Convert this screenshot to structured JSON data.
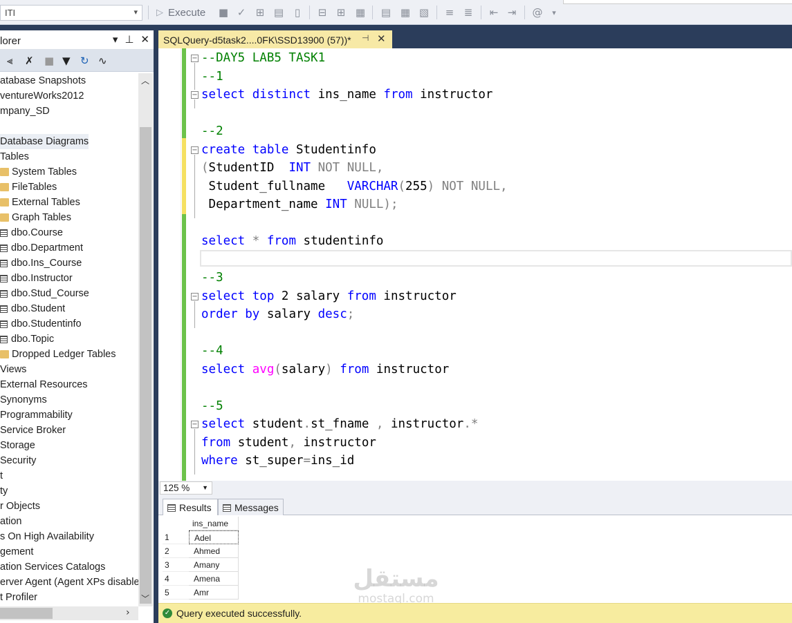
{
  "toolbar": {
    "database": "ITI",
    "execute_label": "Execute",
    "icons": [
      "stop-icon",
      "parse-icon",
      "estimated-plan-icon",
      "query-designer-icon",
      "save-icon",
      "results-to-text-icon",
      "results-to-grid-icon",
      "results-to-file-icon",
      "comment-icon",
      "uncomment-icon",
      "outdent-icon",
      "indent-icon",
      "specify-values-icon"
    ]
  },
  "explorer": {
    "title": "lorer",
    "tree": [
      {
        "label": "atabase Snapshots",
        "icon": "none",
        "indent": 0
      },
      {
        "label": "ventureWorks2012",
        "icon": "none",
        "indent": 0
      },
      {
        "label": "mpany_SD",
        "icon": "none",
        "indent": 0
      },
      {
        "label": "",
        "icon": "none",
        "indent": 0
      },
      {
        "label": "Database Diagrams",
        "icon": "none",
        "indent": 0,
        "selected": true
      },
      {
        "label": "Tables",
        "icon": "none",
        "indent": 0
      },
      {
        "label": "System Tables",
        "icon": "folder",
        "indent": 1
      },
      {
        "label": "FileTables",
        "icon": "folder",
        "indent": 1
      },
      {
        "label": "External Tables",
        "icon": "folder",
        "indent": 1
      },
      {
        "label": "Graph Tables",
        "icon": "folder",
        "indent": 1
      },
      {
        "label": "dbo.Course",
        "icon": "table",
        "indent": 1
      },
      {
        "label": "dbo.Department",
        "icon": "table",
        "indent": 1
      },
      {
        "label": "dbo.Ins_Course",
        "icon": "table",
        "indent": 1
      },
      {
        "label": "dbo.Instructor",
        "icon": "table",
        "indent": 1
      },
      {
        "label": "dbo.Stud_Course",
        "icon": "table",
        "indent": 1
      },
      {
        "label": "dbo.Student",
        "icon": "table",
        "indent": 1
      },
      {
        "label": "dbo.Studentinfo",
        "icon": "table",
        "indent": 1
      },
      {
        "label": "dbo.Topic",
        "icon": "table",
        "indent": 1
      },
      {
        "label": "Dropped Ledger Tables",
        "icon": "folder",
        "indent": 1
      },
      {
        "label": "Views",
        "icon": "none",
        "indent": 0
      },
      {
        "label": "External Resources",
        "icon": "none",
        "indent": 0
      },
      {
        "label": "Synonyms",
        "icon": "none",
        "indent": 0
      },
      {
        "label": "Programmability",
        "icon": "none",
        "indent": 0
      },
      {
        "label": "Service Broker",
        "icon": "none",
        "indent": 0
      },
      {
        "label": "Storage",
        "icon": "none",
        "indent": 0
      },
      {
        "label": "Security",
        "icon": "none",
        "indent": 0
      },
      {
        "label": "t",
        "icon": "none",
        "indent": 0
      },
      {
        "label": "ty",
        "icon": "none",
        "indent": 0
      },
      {
        "label": "r Objects",
        "icon": "none",
        "indent": 0
      },
      {
        "label": "ation",
        "icon": "none",
        "indent": 0
      },
      {
        "label": "s On High Availability",
        "icon": "none",
        "indent": 0
      },
      {
        "label": "gement",
        "icon": "none",
        "indent": 0
      },
      {
        "label": "ation Services Catalogs",
        "icon": "none",
        "indent": 0
      },
      {
        "label": "erver Agent (Agent XPs disable",
        "icon": "none",
        "indent": 0
      },
      {
        "label": "t Profiler",
        "icon": "none",
        "indent": 0
      }
    ]
  },
  "editor": {
    "tab_title": "SQLQuery-d5task2....0FK\\SSD13900 (57))*",
    "lines": [
      {
        "tokens": [
          [
            "cm",
            "--DAY5 LAB5 TASK1"
          ]
        ],
        "fold": "start"
      },
      {
        "tokens": [
          [
            "cm",
            "--1"
          ]
        ]
      },
      {
        "tokens": [
          [
            "kw",
            "select"
          ],
          [
            "tx",
            " "
          ],
          [
            "kw",
            "distinct"
          ],
          [
            "tx",
            " ins_name "
          ],
          [
            "kw",
            "from"
          ],
          [
            "tx",
            " instructor"
          ]
        ],
        "fold": "start"
      },
      {
        "tokens": []
      },
      {
        "tokens": [
          [
            "cm",
            "--2"
          ]
        ]
      },
      {
        "tokens": [
          [
            "kw",
            "create"
          ],
          [
            "tx",
            " "
          ],
          [
            "kw",
            "table"
          ],
          [
            "tx",
            " Studentinfo"
          ]
        ],
        "fold": "start"
      },
      {
        "tokens": [
          [
            "gr",
            "("
          ],
          [
            "tx",
            "StudentID  "
          ],
          [
            "kw",
            "INT"
          ],
          [
            "tx",
            " "
          ],
          [
            "gr",
            "NOT NULL,"
          ]
        ]
      },
      {
        "tokens": [
          [
            "tx",
            " Student_fullname   "
          ],
          [
            "kw",
            "VARCHAR"
          ],
          [
            "gr",
            "("
          ],
          [
            "tx",
            "255"
          ],
          [
            "gr",
            ")"
          ],
          [
            "tx",
            " "
          ],
          [
            "gr",
            "NOT NULL,"
          ]
        ]
      },
      {
        "tokens": [
          [
            "tx",
            " Department_name "
          ],
          [
            "kw",
            "INT"
          ],
          [
            "tx",
            " "
          ],
          [
            "gr",
            "NULL);"
          ]
        ]
      },
      {
        "tokens": []
      },
      {
        "tokens": [
          [
            "kw",
            "select"
          ],
          [
            "tx",
            " "
          ],
          [
            "gr",
            "*"
          ],
          [
            "tx",
            " "
          ],
          [
            "kw",
            "from"
          ],
          [
            "tx",
            " studentinfo"
          ]
        ]
      },
      {
        "tokens": []
      },
      {
        "tokens": [
          [
            "cm",
            "--3"
          ]
        ]
      },
      {
        "tokens": [
          [
            "kw",
            "select"
          ],
          [
            "tx",
            " "
          ],
          [
            "kw",
            "top"
          ],
          [
            "tx",
            " 2 salary "
          ],
          [
            "kw",
            "from"
          ],
          [
            "tx",
            " instructor"
          ]
        ],
        "fold": "start"
      },
      {
        "tokens": [
          [
            "kw",
            "order"
          ],
          [
            "tx",
            " "
          ],
          [
            "kw",
            "by"
          ],
          [
            "tx",
            " salary "
          ],
          [
            "kw",
            "desc"
          ],
          [
            "gr",
            ";"
          ]
        ]
      },
      {
        "tokens": []
      },
      {
        "tokens": [
          [
            "cm",
            "--4"
          ]
        ]
      },
      {
        "tokens": [
          [
            "kw",
            "select"
          ],
          [
            "tx",
            " "
          ],
          [
            "fn",
            "avg"
          ],
          [
            "gr",
            "("
          ],
          [
            "tx",
            "salary"
          ],
          [
            "gr",
            ")"
          ],
          [
            "tx",
            " "
          ],
          [
            "kw",
            "from"
          ],
          [
            "tx",
            " instructor"
          ]
        ]
      },
      {
        "tokens": []
      },
      {
        "tokens": [
          [
            "cm",
            "--5"
          ]
        ]
      },
      {
        "tokens": [
          [
            "kw",
            "select"
          ],
          [
            "tx",
            " student"
          ],
          [
            "gr",
            "."
          ],
          [
            "tx",
            "st_fname "
          ],
          [
            "gr",
            ","
          ],
          [
            "tx",
            " instructor"
          ],
          [
            "gr",
            "."
          ],
          [
            "gr",
            "*"
          ]
        ],
        "fold": "start"
      },
      {
        "tokens": [
          [
            "kw",
            "from"
          ],
          [
            "tx",
            " student"
          ],
          [
            "gr",
            ","
          ],
          [
            "tx",
            " instructor"
          ]
        ]
      },
      {
        "tokens": [
          [
            "kw",
            "where"
          ],
          [
            "tx",
            " st_super"
          ],
          [
            "gr",
            "="
          ],
          [
            "tx",
            "ins_id"
          ]
        ]
      }
    ]
  },
  "zoom": "125 %",
  "results": {
    "tabs": [
      "Results",
      "Messages"
    ],
    "columns": [
      "ins_name"
    ],
    "rows": [
      {
        "num": "1",
        "ins_name": "Adel"
      },
      {
        "num": "2",
        "ins_name": "Ahmed"
      },
      {
        "num": "3",
        "ins_name": "Amany"
      },
      {
        "num": "4",
        "ins_name": "Amena"
      },
      {
        "num": "5",
        "ins_name": "Amr"
      }
    ]
  },
  "watermark": {
    "arabic": "مستقل",
    "latin": "mostaql.com"
  },
  "status": {
    "message": "Query executed successfully."
  },
  "colors": {
    "keyword": "#0000ff",
    "comment": "#008000",
    "operator": "#808080",
    "function": "#ff00ff",
    "status_bg": "#f7ec9f",
    "tab_bg": "#f7e9a6",
    "chrome": "#2b3d5b"
  }
}
